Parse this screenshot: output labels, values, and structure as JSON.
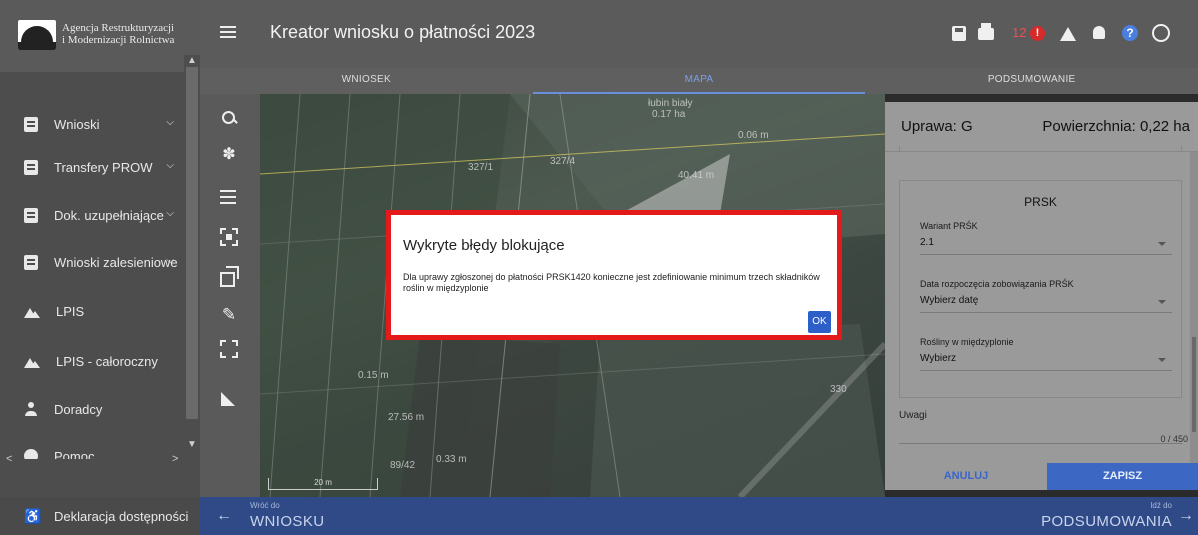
{
  "sidebar": {
    "logo_line1": "Agencja Restrukturyzacji",
    "logo_line2": "i Modernizacji Rolnictwa",
    "items": [
      {
        "label": "Wnioski"
      },
      {
        "label": "Transfery PROW"
      },
      {
        "label": "Dok. uzupełniające"
      },
      {
        "label": "Wnioski zalesieniowe"
      },
      {
        "label": "LPIS"
      },
      {
        "label": "LPIS - całoroczny"
      },
      {
        "label": "Doradcy"
      },
      {
        "label": "Pomoc"
      }
    ],
    "footer_label": "Deklaracja dostępności"
  },
  "header": {
    "title": "Kreator wniosku o płatności 2023",
    "error_count": "12"
  },
  "tabs": [
    {
      "label": "WNIOSEK"
    },
    {
      "label": "MAPA"
    },
    {
      "label": "PODSUMOWANIE"
    }
  ],
  "map": {
    "labels": [
      "łubin biały",
      "0.17 ha",
      "0.06 m",
      "327/1",
      "327/4",
      "40.41 m",
      "0.15 m",
      "27.56 m",
      "330",
      "89/42",
      "0.33 m",
      "20 m"
    ]
  },
  "panel": {
    "crop_label": "Uprawa: G",
    "area_label": "Powierzchnia: 0,22 ha",
    "section_title": "PRSK",
    "fields": [
      {
        "label": "Wariant PRŚK",
        "value": "2.1"
      },
      {
        "label": "Data rozpoczęcia zobowiązania PRŚK",
        "value": "Wybierz datę"
      },
      {
        "label": "Rośliny w międzyplonie",
        "value": "Wybierz"
      }
    ],
    "notes_label": "Uwagi",
    "notes_counter": "0 / 450",
    "cancel_label": "ANULUJ",
    "save_label": "ZAPISZ"
  },
  "bottom": {
    "back_small": "Wróć do",
    "back_label": "WNIOSKU",
    "next_small": "Idź do",
    "next_label": "PODSUMOWANIA"
  },
  "modal": {
    "title": "Wykryte błędy blokujące",
    "message": "Dla uprawy zgłoszonej do płatności PRSK1420 konieczne jest zdefiniowanie minimum trzech składników roślin w międzyplonie",
    "ok_label": "OK"
  },
  "colors": {
    "modal_border": "#e41a1a",
    "accent_blue": "#3c68c4",
    "error_red": "#d72b2b"
  }
}
